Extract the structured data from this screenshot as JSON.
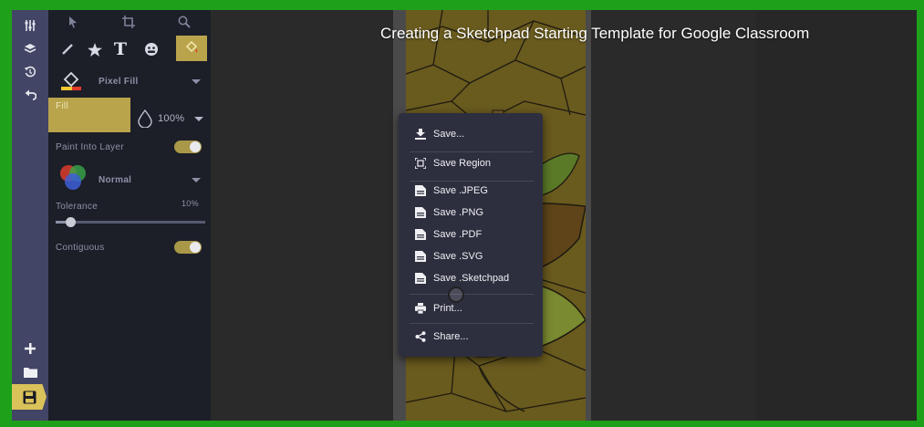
{
  "video": {
    "title": "Creating a Sketchpad Starting Template for Google Classroom"
  },
  "colors": {
    "border": "#1fa01a",
    "rail": "#424565",
    "panel": "#1c1e28",
    "accent": "#d9c25a",
    "fill_swatch": "#b9a44c",
    "menu_bg": "#2d2f3f"
  },
  "rail": {
    "icons": [
      "sliders-icon",
      "layers-icon",
      "history-icon",
      "undo-icon",
      "add-icon",
      "folder-icon",
      "save-icon"
    ]
  },
  "tools": {
    "top": [
      "pointer-icon",
      "crop-icon",
      "zoom-icon"
    ],
    "row2": [
      "brush-icon",
      "star-icon",
      "text-icon",
      "emoji-icon",
      "fill-icon"
    ],
    "text_tool_glyph": "T"
  },
  "panel": {
    "tool_name": "Pixel Fill",
    "fill_label": "Fill",
    "opacity": "100%",
    "paint_into_layer": "Paint Into Layer",
    "blend_mode": "Normal",
    "tolerance_label": "Tolerance",
    "tolerance_value": "10%",
    "tolerance_level": 0.1,
    "contiguous": "Contiguous"
  },
  "menu": {
    "items": [
      {
        "label": "Save...",
        "icon": "download-icon"
      },
      {
        "label": "Save Region",
        "icon": "region-icon"
      },
      {
        "label": "Save .JPEG",
        "icon": "file-icon"
      },
      {
        "label": "Save .PNG",
        "icon": "file-icon"
      },
      {
        "label": "Save .PDF",
        "icon": "file-icon"
      },
      {
        "label": "Save .SVG",
        "icon": "file-icon"
      },
      {
        "label": "Save .Sketchpad",
        "icon": "file-icon"
      },
      {
        "label": "Print...",
        "icon": "print-icon"
      },
      {
        "label": "Share...",
        "icon": "share-icon"
      }
    ]
  }
}
